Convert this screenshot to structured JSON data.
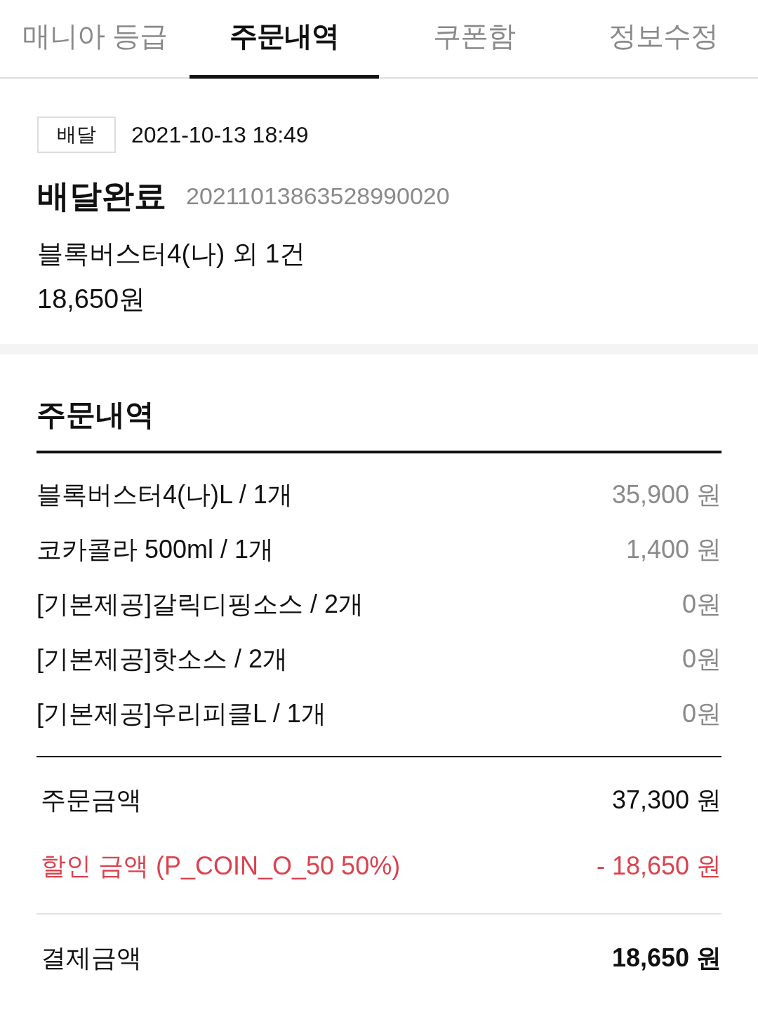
{
  "tabs": [
    {
      "label": "매니아 등급",
      "selected": false
    },
    {
      "label": "주문내역",
      "selected": true
    },
    {
      "label": "쿠폰함",
      "selected": false
    },
    {
      "label": "정보수정",
      "selected": false
    }
  ],
  "order": {
    "type_badge": "배달",
    "datetime": "2021-10-13 18:49",
    "status": "배달완료",
    "order_number": "20211013863528990020",
    "summary": "블록버스터4(나) 외 1건",
    "total": "18,650원"
  },
  "details": {
    "title": "주문내역",
    "items": [
      {
        "name": "블록버스터4(나)L / 1개",
        "price": "35,900 원"
      },
      {
        "name": "코카콜라 500ml / 1개",
        "price": "1,400 원"
      },
      {
        "name": "[기본제공]갈릭디핑소스 / 2개",
        "price": "0원"
      },
      {
        "name": "[기본제공]핫소스 / 2개",
        "price": "0원"
      },
      {
        "name": "[기본제공]우리피클L / 1개",
        "price": "0원"
      }
    ],
    "totals": [
      {
        "kind": "subtotal",
        "label": "주문금액",
        "amount": "37,300 원"
      },
      {
        "kind": "discount",
        "label": "할인 금액 (P_COIN_O_50 50%)",
        "amount": "- 18,650 원"
      },
      {
        "kind": "payment",
        "label": "결제금액",
        "amount": "18,650 원"
      }
    ]
  }
}
